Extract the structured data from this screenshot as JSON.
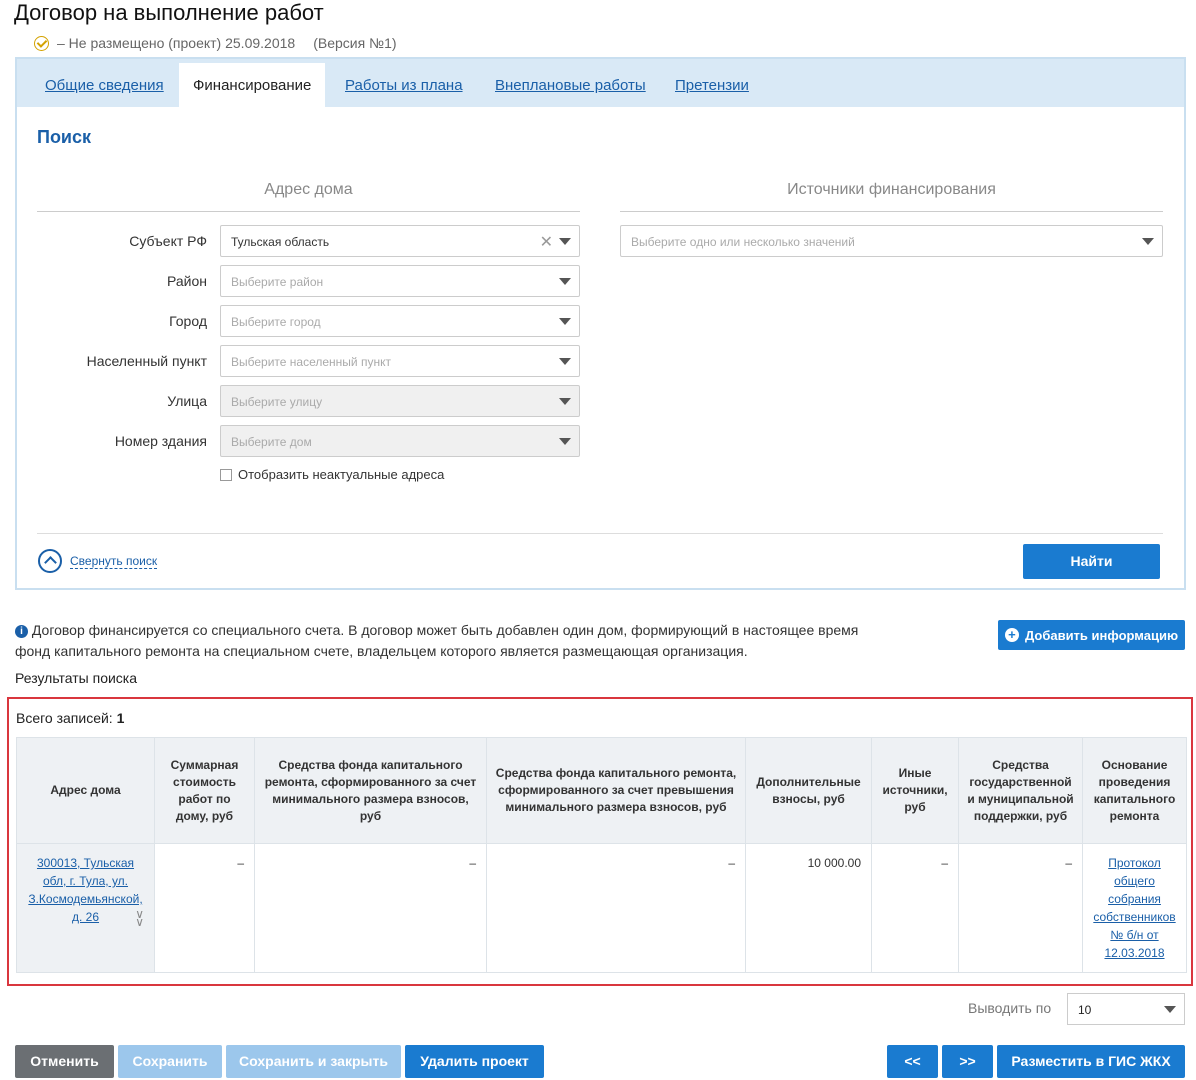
{
  "page": {
    "title": "Договор на выполнение работ",
    "status": "–  Не размещено (проект) 25.09.2018",
    "version": "(Версия №1)"
  },
  "tabs": [
    {
      "label": "Общие сведения",
      "active": false
    },
    {
      "label": "Финансирование",
      "active": true
    },
    {
      "label": "Работы из плана",
      "active": false
    },
    {
      "label": "Внеплановые работы",
      "active": false
    },
    {
      "label": "Претензии",
      "active": false
    }
  ],
  "search": {
    "title": "Поиск",
    "address_title": "Адрес дома",
    "sources_title": "Источники финансирования",
    "fields": [
      {
        "label": "Субъект РФ",
        "value": "Тульская область",
        "placeholder": "",
        "disabled": false
      },
      {
        "label": "Район",
        "value": "",
        "placeholder": "Выберите район",
        "disabled": false
      },
      {
        "label": "Город",
        "value": "",
        "placeholder": "Выберите город",
        "disabled": false
      },
      {
        "label": "Населенный пункт",
        "value": "",
        "placeholder": "Выберите населенный пункт",
        "disabled": false
      },
      {
        "label": "Улица",
        "value": "",
        "placeholder": "Выберите улицу",
        "disabled": true
      },
      {
        "label": "Номер здания",
        "value": "",
        "placeholder": "Выберите дом",
        "disabled": true
      }
    ],
    "sources_placeholder": "Выберите одно или несколько значений",
    "show_inactive_label": "Отобразить неактуальные адреса",
    "collapse_label": "Свернуть поиск",
    "find_button": "Найти"
  },
  "info": {
    "text": "Договор финансируется со специального счета. В договор может быть добавлен один дом, формирующий в настоящее время фонд капитального ремонта на специальном счете, владельцем которого является размещающая организация.",
    "add_button": "Добавить информацию"
  },
  "results": {
    "title": "Результаты поиска",
    "total_label": "Всего записей:",
    "total_value": "1",
    "columns": [
      "Адрес дома",
      "Суммарная стоимость работ по дому, руб",
      "Средства фонда капитального ремонта, сформированного за счет минимального размера взносов, руб",
      "Средства фонда капитального ремонта, сформированного за счет превышения минимального размера взносов, руб",
      "Дополнительные взносы, руб",
      "Иные источники, руб",
      "Средства государственной и муниципальной поддержки, руб",
      "Основание проведения капитального ремонта"
    ],
    "rows": [
      {
        "address": "300013, Тульская обл, г. Тула, ул. З.Космодемьянской, д. 26",
        "total_cost": "–",
        "fund_min": "–",
        "fund_excess": "–",
        "additional": "10 000.00",
        "other": "–",
        "state_support": "–",
        "basis": "Протокол общего собрания собственников № б/н от 12.03.2018"
      }
    ]
  },
  "pagination": {
    "per_page_label": "Выводить по",
    "per_page_value": "10",
    "prev": "<<",
    "next": ">>"
  },
  "footer": {
    "cancel": "Отменить",
    "save": "Сохранить",
    "save_close": "Сохранить и закрыть",
    "delete": "Удалить проект",
    "publish": "Разместить в ГИС ЖКХ"
  }
}
